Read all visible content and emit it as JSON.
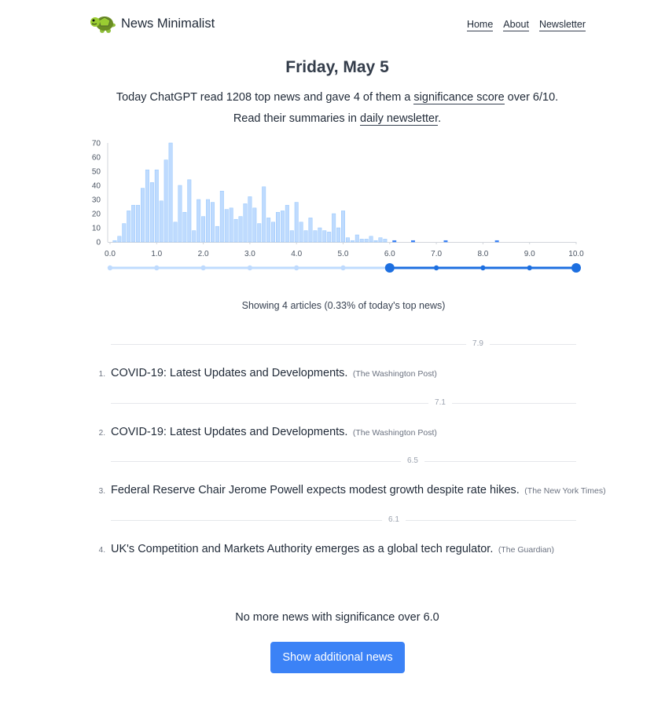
{
  "header": {
    "brand": "News Minimalist",
    "logo_icon": "turtle-icon",
    "nav": {
      "home": "Home",
      "about": "About",
      "newsletter": "Newsletter"
    }
  },
  "date": "Friday, May 5",
  "intro": {
    "line1_pre": "Today ChatGPT read 1208 top news and gave 4 of them a ",
    "line1_link": "significance score",
    "line1_post": " over 6/10.",
    "line2_pre": "Read their summaries in ",
    "line2_link": "daily newsletter",
    "line2_post": "."
  },
  "chart_data": {
    "type": "bar",
    "x_ticks": [
      "0.0",
      "1.0",
      "2.0",
      "3.0",
      "4.0",
      "5.0",
      "6.0",
      "7.0",
      "8.0",
      "9.0",
      "10.0"
    ],
    "y_ticks": [
      "0",
      "10",
      "20",
      "30",
      "40",
      "50",
      "60",
      "70"
    ],
    "xlim": [
      0,
      10
    ],
    "ylim": [
      0,
      70
    ],
    "bin_width": 0.1,
    "bin_start": 0.1,
    "values": [
      1,
      4,
      13,
      22,
      26,
      26,
      38,
      51,
      42,
      51,
      29,
      58,
      70,
      14,
      40,
      21,
      44,
      8,
      30,
      18,
      30,
      28,
      11,
      36,
      23,
      24,
      16,
      18,
      27,
      32,
      24,
      13,
      39,
      17,
      14,
      21,
      22,
      26,
      8,
      28,
      14,
      8,
      17,
      8,
      10,
      8,
      7,
      20,
      10,
      22,
      3,
      1,
      5,
      2,
      2,
      4,
      1,
      3,
      2,
      0,
      1,
      0,
      0,
      0,
      1,
      0,
      0,
      0,
      0,
      0,
      0,
      1,
      0,
      0,
      0,
      0,
      0,
      0,
      0,
      0,
      0,
      0,
      1
    ],
    "threshold": 6.0,
    "colors": {
      "bar": "#bfdbfe",
      "bar_highlight": "#3b82f6",
      "slider_inactive": "#bfdbfe",
      "slider_active": "#1d6fe0"
    }
  },
  "showing": "Showing 4 articles (0.33% of today's top news)",
  "articles": [
    {
      "score": "7.9",
      "num": "1.",
      "title": "COVID-19: Latest Updates and Developments.",
      "source": "(The Washington Post)"
    },
    {
      "score": "7.1",
      "num": "2.",
      "title": "COVID-19: Latest Updates and Developments.",
      "source": "(The Washington Post)"
    },
    {
      "score": "6.5",
      "num": "3.",
      "title": "Federal Reserve Chair Jerome Powell expects modest growth despite rate hikes.",
      "source": "(The New York Times)"
    },
    {
      "score": "6.1",
      "num": "4.",
      "title": "UK's Competition and Markets Authority emerges as a global tech regulator.",
      "source": "(The Guardian)"
    }
  ],
  "no_more": "No more news with significance over 6.0",
  "button_label": "Show additional news"
}
